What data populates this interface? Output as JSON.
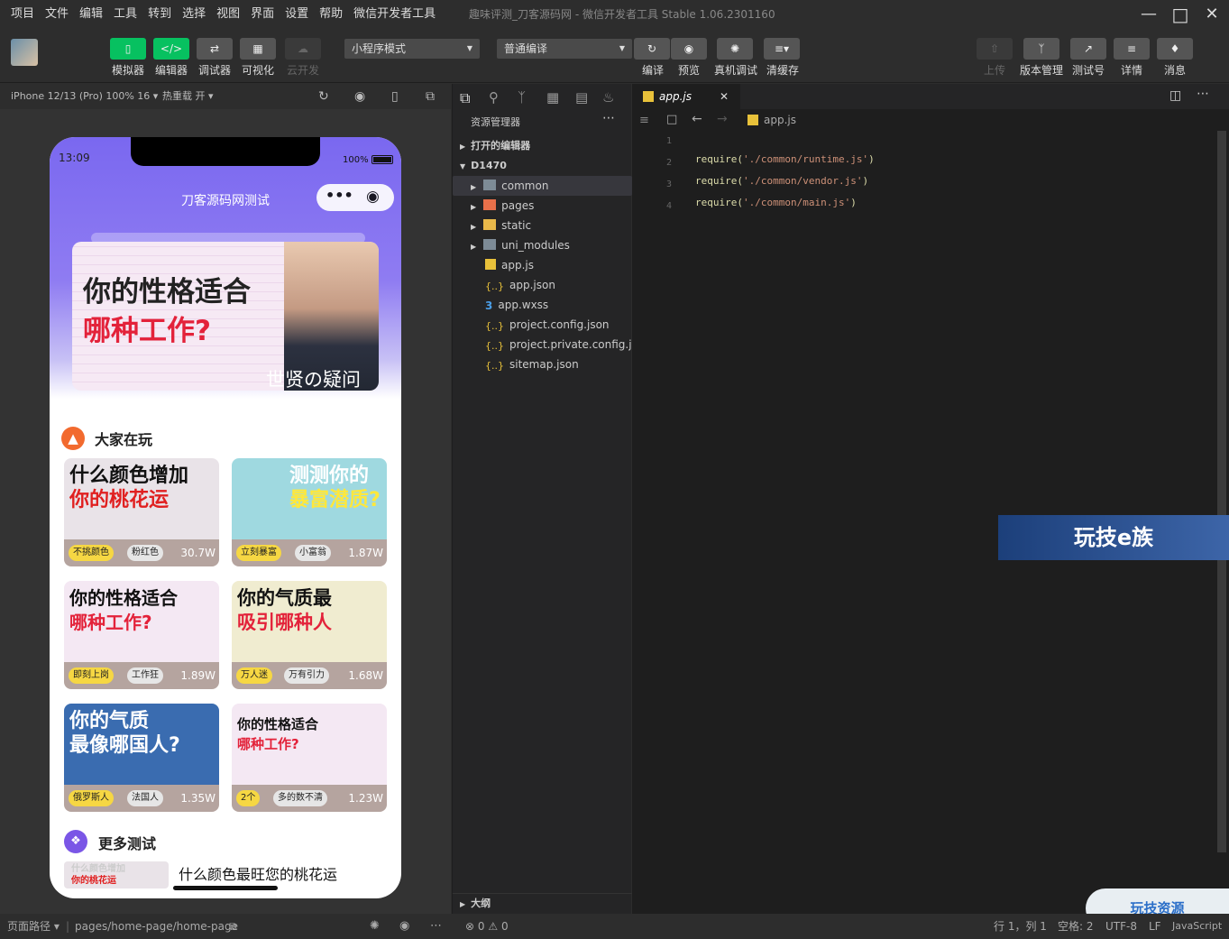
{
  "menu": [
    "项目",
    "文件",
    "编辑",
    "工具",
    "转到",
    "选择",
    "视图",
    "界面",
    "设置",
    "帮助",
    "微信开发者工具"
  ],
  "window_title": "趣味评测_刀客源码网 - 微信开发者工具 Stable 1.06.2301160",
  "toolbar": {
    "simulator": "模拟器",
    "editor": "编辑器",
    "debugger": "调试器",
    "visual": "可视化",
    "cloud": "云开发",
    "mode_select": "小程序模式",
    "compile_select": "普通编译",
    "compile": "编译",
    "preview": "预览",
    "real_debug": "真机调试",
    "clear_cache": "清缓存",
    "upload": "上传",
    "version": "版本管理",
    "test_account": "测试号",
    "details": "详情",
    "messages": "消息"
  },
  "simbar": {
    "device": "iPhone 12/13 (Pro) 100% 16 ▾",
    "hot_reload": "热重载 开 ▾"
  },
  "phone": {
    "time": "13:09",
    "battery": "100%",
    "nav_title": "刀客源码网测试",
    "banner_line1": "你的性格适合",
    "banner_line2": "哪种工作?",
    "banner_caption": "世贤の疑问",
    "section1": "大家在玩",
    "section2": "更多测试",
    "cards": [
      {
        "title1": "什么颜色增加",
        "title2": "你的桃花运",
        "tag1": "不挑颜色",
        "tag2": "粉红色",
        "count": "30.7W",
        "bg": "#e9e3e8"
      },
      {
        "title1": "测测你的",
        "title2": "暴富潜质?",
        "tag1": "立刻暴富",
        "tag2": "小富翁",
        "count": "1.87W",
        "bg": "#9fd9e0"
      },
      {
        "title1": "你的性格适合",
        "title2": "哪种工作?",
        "tag1": "即刻上岗",
        "tag2": "工作狂",
        "count": "1.89W",
        "bg": "#f4e8f3"
      },
      {
        "title1": "你的气质最",
        "title2": "吸引哪种人",
        "tag1": "万人迷",
        "tag2": "万有引力",
        "count": "1.68W",
        "bg": "#f0ecd0"
      },
      {
        "title1": "你的气质",
        "title2": "最像哪国人?",
        "tag1": "俄罗斯人",
        "tag2": "法国人",
        "count": "1.35W",
        "bg": "#3a6cb0"
      },
      {
        "title1": "你的性格适合",
        "title2": "哪种工作?",
        "tag1": "2个",
        "tag2": "多的数不清",
        "count": "1.23W",
        "bg": "#f4e8f3"
      }
    ],
    "list_item": "什么颜色最旺您的桃花运",
    "list_thumb1": "什么颜色增加",
    "list_thumb2": "你的桃花运"
  },
  "explorer": {
    "title": "资源管理器",
    "open_editors": "打开的编辑器",
    "project": "D1470",
    "items": [
      "common",
      "pages",
      "static",
      "uni_modules",
      "app.js",
      "app.json",
      "app.wxss",
      "project.config.json",
      "project.private.config.js...",
      "sitemap.json"
    ],
    "outline": "大纲"
  },
  "editor": {
    "tab": "app.js",
    "breadcrumb": "app.js",
    "lines": [
      "1",
      "2",
      "3",
      "4"
    ],
    "code": [
      "",
      "require('./common/runtime.js')",
      "require('./common/vendor.js')",
      "require('./common/main.js')"
    ]
  },
  "watermark": "玩技e族",
  "watermark2": "玩技资源",
  "status": {
    "page_path_label": "页面路径 ▾",
    "page_path": "pages/home-page/home-page",
    "errors": "0",
    "warnings": "0",
    "cursor": "行 1，列 1",
    "spaces": "空格: 2",
    "encoding": "UTF-8",
    "eol": "LF",
    "language": "JavaScript"
  },
  "colors": {
    "accent": "#07c160",
    "header_purple": "#7b6cf0"
  }
}
